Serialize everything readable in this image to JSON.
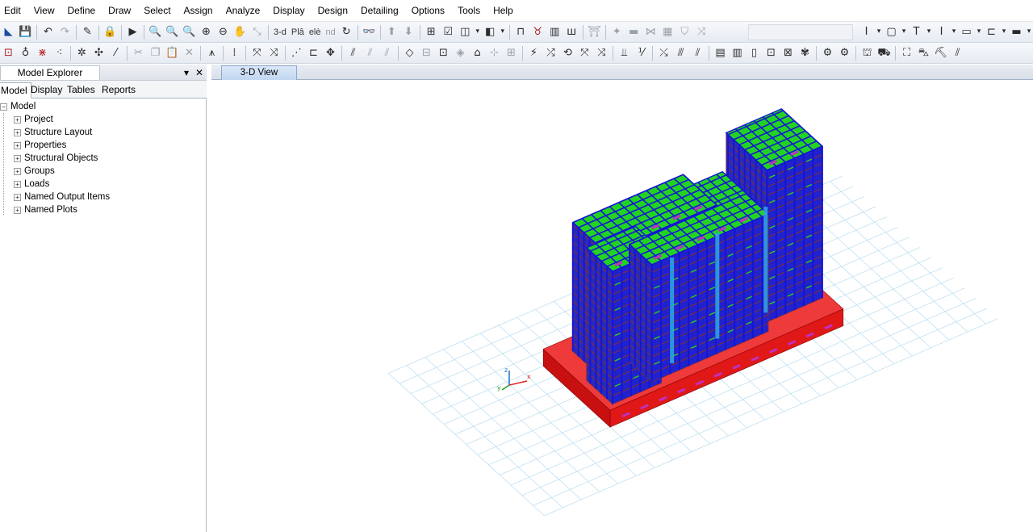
{
  "menubar": {
    "items": [
      "Edit",
      "View",
      "Define",
      "Draw",
      "Select",
      "Assign",
      "Analyze",
      "Display",
      "Design",
      "Detailing",
      "Options",
      "Tools",
      "Help"
    ]
  },
  "toolbar": {
    "view_3d_label": "3-d",
    "plan_label": "Plâ",
    "elev_label": "elè",
    "nd_label": "nd"
  },
  "explorer": {
    "title": "Model Explorer",
    "pin_glyph": "▾",
    "close_glyph": "✕",
    "tabs": [
      "Model",
      "Display",
      "Tables",
      "Reports"
    ],
    "active_tab": "Model",
    "tree": {
      "root": "Model",
      "root_expander": "−",
      "child_expander": "+",
      "children": [
        "Project",
        "Structure Layout",
        "Properties",
        "Structural Objects",
        "Groups",
        "Loads",
        "Named Output Items",
        "Named Plots"
      ]
    }
  },
  "view": {
    "tab_label": "3-D View",
    "axis_labels": {
      "x": "x",
      "y": "y",
      "z": "z"
    }
  },
  "colors": {
    "columns": "#1515d6",
    "beams": "#7a2f3a",
    "slabs": "#22d322",
    "braces": "#c030c0",
    "walls": "#30a8e6",
    "foundation": "#e01818",
    "grid": "#b8dcf0"
  }
}
